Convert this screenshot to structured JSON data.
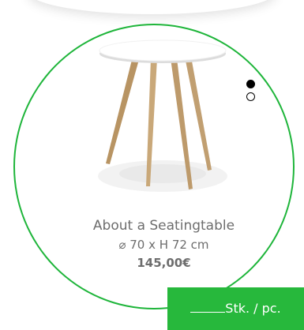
{
  "product": {
    "name": "About a Seatingtable",
    "dimensions": "⌀ 70 x H 72 cm",
    "price": "145,00€",
    "image": "round white-top table with four oak legs"
  },
  "carousel": {
    "dots": [
      {
        "state": "active"
      },
      {
        "state": "inactive"
      }
    ]
  },
  "order": {
    "quantity_value": "",
    "quantity_label": "Stk. / pc."
  },
  "colors": {
    "accent_green": "#27b83c",
    "circle_border": "#1eb53a",
    "text_gray": "#6d6d6d"
  }
}
